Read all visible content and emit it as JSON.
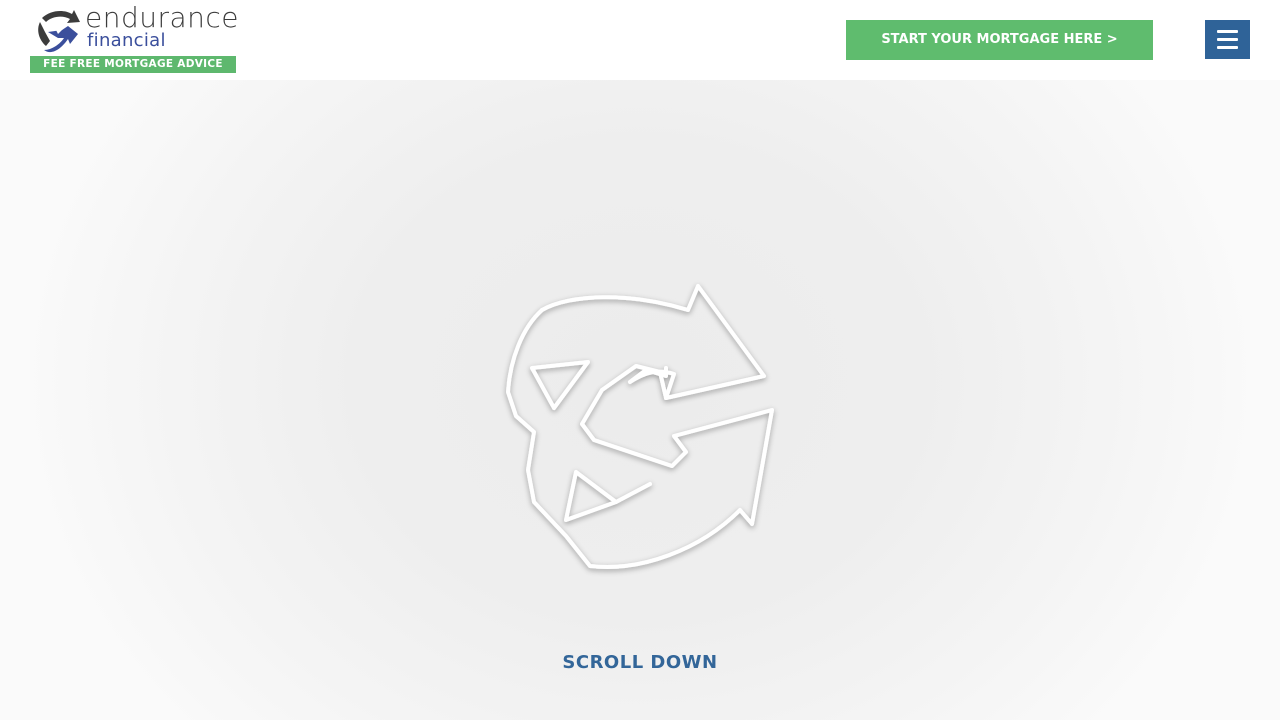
{
  "header": {
    "logo": {
      "word_1": "endurance",
      "word_2": "financial",
      "tagline": "FEE FREE MORTGAGE ADVICE",
      "icon": "endurance-arrows-icon"
    },
    "cta_label": "START YOUR MORTGAGE HERE >",
    "menu_icon": "hamburger-menu-icon"
  },
  "hero": {
    "loader_icon": "endurance-arrows-outline-icon",
    "scroll_label": "SCROLL DOWN"
  },
  "colors": {
    "brand_blue": "#2f6398",
    "brand_green": "#5fbc6e",
    "logo_text_grey": "#3c3c3c",
    "logo_accent_blue": "#3b4f9c",
    "scroll_text": "#336699",
    "hero_background": "#eeeeee"
  }
}
